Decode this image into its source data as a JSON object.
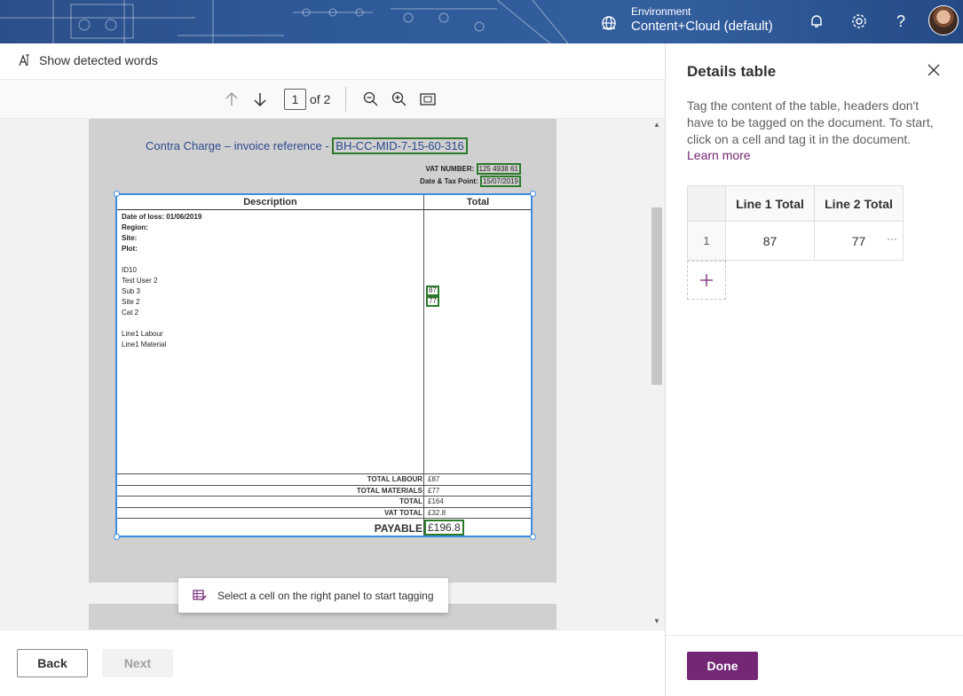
{
  "topbar": {
    "environment_label": "Environment",
    "environment_value": "Content+Cloud (default)",
    "icons": [
      "environment-globe-icon",
      "bell-icon",
      "gear-icon",
      "help-icon",
      "avatar"
    ]
  },
  "command_bar": {
    "show_detected_words": "Show detected words"
  },
  "toolbar": {
    "page_current": "1",
    "page_of": "of 2"
  },
  "document": {
    "title_prefix": "Contra Charge – invoice reference -",
    "reference": "BH-CC-MID-7-15-60-316",
    "vat_number_label": "VAT NUMBER:",
    "vat_number_value": "125 4938 61",
    "tax_point_label": "Date & Tax Point:",
    "tax_point_value": "15/07/2019",
    "table": {
      "col_description": "Description",
      "col_total": "Total",
      "date_of_loss": "Date of loss: 01/06/2019",
      "region": "Region:",
      "site": "Site:",
      "plot": "Plot:",
      "id": "ID10",
      "user": "Test User 2",
      "sub": "Sub 3",
      "site2": "Site 2",
      "cat": "Cat 2",
      "line1_labour": "Line1 Labour",
      "line1_material": "Line1 Material",
      "value_1": "87",
      "value_2": "77",
      "summary": [
        {
          "label": "TOTAL LABOUR",
          "value": "£87"
        },
        {
          "label": "TOTAL MATERIALS",
          "value": "£77"
        },
        {
          "label": "TOTAL",
          "value": "£164"
        },
        {
          "label": "VAT TOTAL",
          "value": "£32.8"
        }
      ],
      "payable_label": "PAYABLE",
      "payable_value": "£196.8"
    }
  },
  "toast": {
    "text": "Select a cell on the right panel to start tagging"
  },
  "footer": {
    "back": "Back",
    "next": "Next"
  },
  "panel": {
    "title": "Details table",
    "description": "Tag the content of the table, headers don't have to be tagged on the document. To start, click on a cell and tag it in the document.",
    "learn_more": "Learn more",
    "table": {
      "headers": [
        "Line 1 Total",
        "Line 2 Total"
      ],
      "row_number": "1",
      "row_values": [
        "87",
        "77"
      ],
      "more": "···"
    },
    "done": "Done"
  },
  "colors": {
    "accent": "#742774",
    "selection": "#3a8ee6",
    "tag_box": "#2a7a2a"
  }
}
